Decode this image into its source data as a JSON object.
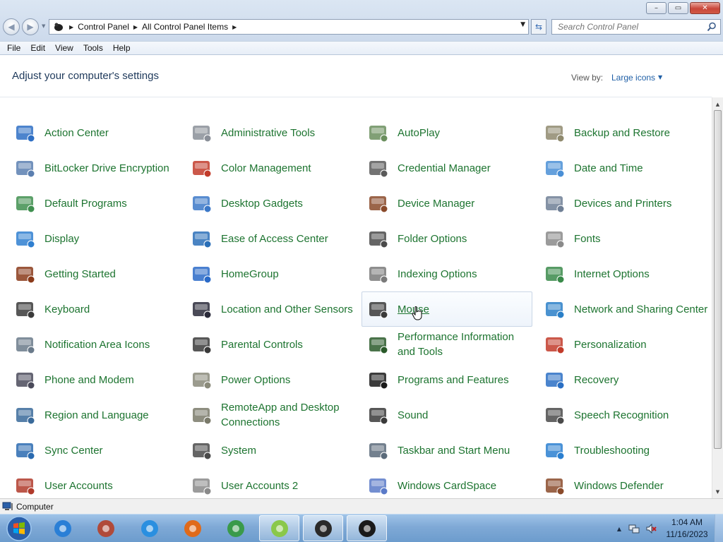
{
  "window": {
    "minimize_label": "–",
    "maximize_label": "▭",
    "close_label": "✕"
  },
  "address_bar": {
    "breadcrumbs": [
      "Control Panel",
      "All Control Panel Items"
    ],
    "search_placeholder": "Search Control Panel"
  },
  "menubar": [
    "File",
    "Edit",
    "View",
    "Tools",
    "Help"
  ],
  "content": {
    "heading": "Adjust your computer's settings",
    "view_by_label": "View by:",
    "view_by_value": "Large icons"
  },
  "items": [
    {
      "label": "Action Center",
      "icon": "action-center-icon",
      "color": "#2e6fc4"
    },
    {
      "label": "Administrative Tools",
      "icon": "administrative-tools-icon",
      "color": "#8a8f98"
    },
    {
      "label": "AutoPlay",
      "icon": "autoplay-icon",
      "color": "#6b8f5e"
    },
    {
      "label": "Backup and Restore",
      "icon": "backup-restore-icon",
      "color": "#8f8a6e"
    },
    {
      "label": "BitLocker Drive Encryption",
      "icon": "bitlocker-icon",
      "color": "#5b7fb0"
    },
    {
      "label": "Color Management",
      "icon": "color-management-icon",
      "color": "#c23b2a"
    },
    {
      "label": "Credential Manager",
      "icon": "credential-manager-icon",
      "color": "#5a5a5a"
    },
    {
      "label": "Date and Time",
      "icon": "date-time-icon",
      "color": "#4a8fd6"
    },
    {
      "label": "Default Programs",
      "icon": "default-programs-icon",
      "color": "#3f8f4f"
    },
    {
      "label": "Desktop Gadgets",
      "icon": "desktop-gadgets-icon",
      "color": "#3b78c8"
    },
    {
      "label": "Device Manager",
      "icon": "device-manager-icon",
      "color": "#8a4a2a"
    },
    {
      "label": "Devices and Printers",
      "icon": "devices-printers-icon",
      "color": "#6f7f95"
    },
    {
      "label": "Display",
      "icon": "display-icon",
      "color": "#2f7fd0"
    },
    {
      "label": "Ease of Access Center",
      "icon": "ease-of-access-icon",
      "color": "#2a6fb8"
    },
    {
      "label": "Folder Options",
      "icon": "folder-options-icon",
      "color": "#4a4a4a"
    },
    {
      "label": "Fonts",
      "icon": "fonts-icon",
      "color": "#8a8a8a"
    },
    {
      "label": "Getting Started",
      "icon": "getting-started-icon",
      "color": "#8a3a1a"
    },
    {
      "label": "HomeGroup",
      "icon": "homegroup-icon",
      "color": "#2a6ac8"
    },
    {
      "label": "Indexing Options",
      "icon": "indexing-options-icon",
      "color": "#7a7a7a"
    },
    {
      "label": "Internet Options",
      "icon": "internet-options-icon",
      "color": "#3a8a4a"
    },
    {
      "label": "Keyboard",
      "icon": "keyboard-icon",
      "color": "#3a3a3a"
    },
    {
      "label": "Location and Other Sensors",
      "icon": "location-sensors-icon",
      "color": "#2a2a3a"
    },
    {
      "label": "Mouse",
      "icon": "mouse-icon",
      "color": "#3a3a3a"
    },
    {
      "label": "Network and Sharing Center",
      "icon": "network-sharing-icon",
      "color": "#2a7fc8"
    },
    {
      "label": "Notification Area Icons",
      "icon": "notification-area-icon",
      "color": "#6a7a8a"
    },
    {
      "label": "Parental Controls",
      "icon": "parental-controls-icon",
      "color": "#3a3a3a"
    },
    {
      "label": "Performance Information and Tools",
      "icon": "performance-icon",
      "color": "#2a5a2a"
    },
    {
      "label": "Personalization",
      "icon": "personalization-icon",
      "color": "#c23b2a"
    },
    {
      "label": "Phone and Modem",
      "icon": "phone-modem-icon",
      "color": "#4a4a5a"
    },
    {
      "label": "Power Options",
      "icon": "power-options-icon",
      "color": "#8a8a7a"
    },
    {
      "label": "Programs and Features",
      "icon": "programs-features-icon",
      "color": "#1a1a1a"
    },
    {
      "label": "Recovery",
      "icon": "recovery-icon",
      "color": "#2a6fc4"
    },
    {
      "label": "Region and Language",
      "icon": "region-language-icon",
      "color": "#3a6a9a"
    },
    {
      "label": "RemoteApp and Desktop Connections",
      "icon": "remoteapp-icon",
      "color": "#7a7a6a"
    },
    {
      "label": "Sound",
      "icon": "sound-icon",
      "color": "#3a3a3a"
    },
    {
      "label": "Speech Recognition",
      "icon": "speech-recognition-icon",
      "color": "#4a4a4a"
    },
    {
      "label": "Sync Center",
      "icon": "sync-center-icon",
      "color": "#2a6ab0"
    },
    {
      "label": "System",
      "icon": "system-icon",
      "color": "#4a4a4a"
    },
    {
      "label": "Taskbar and Start Menu",
      "icon": "taskbar-start-icon",
      "color": "#5a6a7a"
    },
    {
      "label": "Troubleshooting",
      "icon": "troubleshooting-icon",
      "color": "#2a7fd0"
    },
    {
      "label": "User Accounts",
      "icon": "user-accounts-icon",
      "color": "#b03a2a"
    },
    {
      "label": "User Accounts 2",
      "icon": "user-accounts-2-icon",
      "color": "#8a8a8a"
    },
    {
      "label": "Windows CardSpace",
      "icon": "windows-cardspace-icon",
      "color": "#5a7ac8"
    },
    {
      "label": "Windows Defender",
      "icon": "windows-defender-icon",
      "color": "#8a4a2a"
    }
  ],
  "hovered_item": "Mouse",
  "statusbar": {
    "text": "Computer"
  },
  "taskbar": {
    "buttons": [
      {
        "name": "internet-explorer",
        "color": "#2a7fd6"
      },
      {
        "name": "archive-app",
        "color": "#b04a3a"
      },
      {
        "name": "itunes",
        "color": "#2a8fe0"
      },
      {
        "name": "firefox",
        "color": "#e06a1a"
      },
      {
        "name": "chrome",
        "color": "#3a9a4a"
      },
      {
        "name": "android-app",
        "color": "#8ac84a"
      },
      {
        "name": "amd-app",
        "color": "#2a2a2a"
      },
      {
        "name": "control-panel",
        "color": "#1a1a1a"
      }
    ],
    "active_buttons": [
      "android-app",
      "amd-app",
      "control-panel"
    ]
  },
  "tray": {
    "time": "1:04 AM",
    "date": "11/16/2023"
  }
}
